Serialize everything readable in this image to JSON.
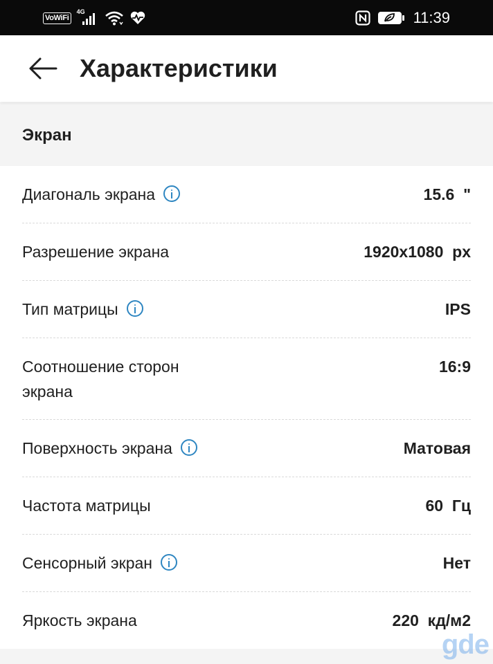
{
  "status_bar": {
    "vowifi": "VoWiFi",
    "network": "4G",
    "time": "11:39"
  },
  "header": {
    "title": "Характеристики"
  },
  "section": {
    "title": "Экран"
  },
  "specs": [
    {
      "label": "Диагональ экрана",
      "value": "15.6  \"",
      "info": true
    },
    {
      "label": "Разрешение экрана",
      "value": "1920x1080  px",
      "info": false
    },
    {
      "label": "Тип матрицы",
      "value": "IPS",
      "info": true
    },
    {
      "label": "Соотношение сторон экрана",
      "value": "16:9",
      "info": false
    },
    {
      "label": "Поверхность экрана",
      "value": "Матовая",
      "info": true
    },
    {
      "label": "Частота матрицы",
      "value": "60  Гц",
      "info": false
    },
    {
      "label": "Сенсорный экран",
      "value": "Нет",
      "info": true
    },
    {
      "label": "Яркость экрана",
      "value": "220  кд/м2",
      "info": false
    }
  ],
  "watermark": "gde",
  "icons": {
    "back": "arrow-left-icon",
    "info": "info-circle-icon"
  },
  "colors": {
    "accent": "#2e86c1",
    "status_bar": "#0a0a0a",
    "section_bg": "#f4f4f4"
  }
}
